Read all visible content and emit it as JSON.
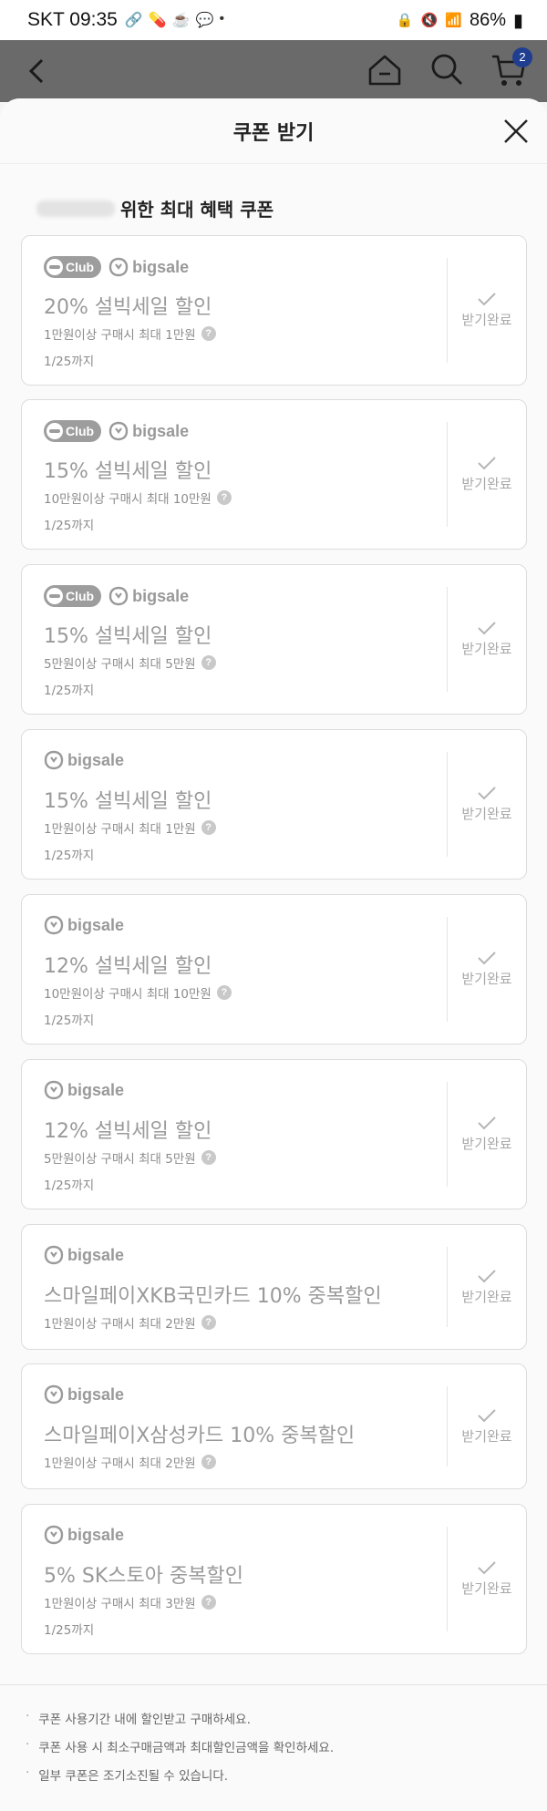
{
  "status_bar": {
    "time_text": "SKT 09:35",
    "battery": "86%"
  },
  "header": {
    "cart_count": "2"
  },
  "modal": {
    "title": "쿠폰 받기",
    "section_title": "위한 최대 혜택 쿠폰"
  },
  "labels": {
    "club": "Club",
    "bigsale": "bigsale"
  },
  "coupons": [
    {
      "club": true,
      "title": "20% 설빅세일 할인",
      "condition": "1만원이상 구매시 최대 1만원",
      "expiry": "1/25까지",
      "status": "받기완료"
    },
    {
      "club": true,
      "title": "15% 설빅세일 할인",
      "condition": "10만원이상 구매시 최대 10만원",
      "expiry": "1/25까지",
      "status": "받기완료"
    },
    {
      "club": true,
      "title": "15% 설빅세일 할인",
      "condition": "5만원이상 구매시 최대 5만원",
      "expiry": "1/25까지",
      "status": "받기완료"
    },
    {
      "club": false,
      "title": "15% 설빅세일 할인",
      "condition": "1만원이상 구매시 최대 1만원",
      "expiry": "1/25까지",
      "status": "받기완료"
    },
    {
      "club": false,
      "title": "12% 설빅세일 할인",
      "condition": "10만원이상 구매시 최대 10만원",
      "expiry": "1/25까지",
      "status": "받기완료"
    },
    {
      "club": false,
      "title": "12% 설빅세일 할인",
      "condition": "5만원이상 구매시 최대 5만원",
      "expiry": "1/25까지",
      "status": "받기완료"
    },
    {
      "club": false,
      "title": "스마일페이XKB국민카드 10% 중복할인",
      "condition": "1만원이상 구매시 최대 2만원",
      "expiry": "",
      "status": "받기완료"
    },
    {
      "club": false,
      "title": "스마일페이X삼성카드 10% 중복할인",
      "condition": "1만원이상 구매시 최대 2만원",
      "expiry": "",
      "status": "받기완료"
    },
    {
      "club": false,
      "title": "5% SK스토아 중복할인",
      "condition": "1만원이상 구매시 최대 3만원",
      "expiry": "1/25까지",
      "status": "받기완료"
    }
  ],
  "notices": [
    "쿠폰 사용기간 내에 할인받고 구매하세요.",
    "쿠폰 사용 시 최소구매금액과 최대할인금액을 확인하세요.",
    "일부 쿠폰은 조기소진될 수 있습니다."
  ],
  "icons": {
    "back": "chevron-left-icon",
    "home": "home-icon",
    "search": "search-icon",
    "cart": "cart-icon",
    "close": "close-icon",
    "check": "check-icon",
    "help": "question-icon"
  }
}
